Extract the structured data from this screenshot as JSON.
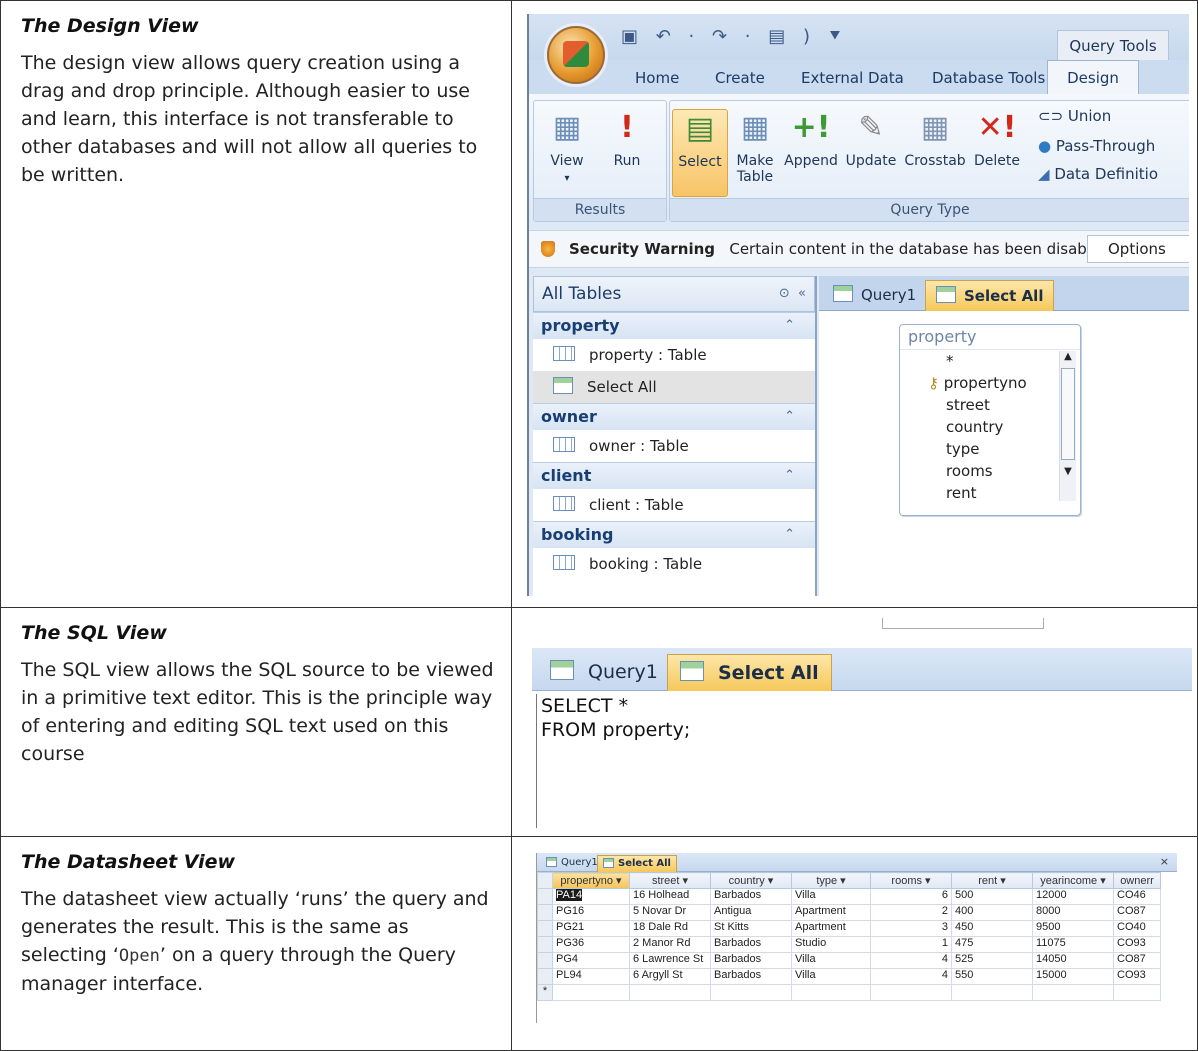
{
  "rows": [
    {
      "title": "The Design View",
      "body": "The design view allows query creation using a drag and drop principle. Although easier to use and learn, this interface is not transferable to other databases and will not allow all queries to be written."
    },
    {
      "title": "The SQL View",
      "body": "The SQL view allows the SQL source to be viewed in a primitive text editor. This is the principle way of entering and editing SQL text used on this course"
    },
    {
      "title": "The Datasheet View",
      "body_before": "The datasheet view actually ‘runs’ the query and generates the result. This is the same as selecting ‘",
      "body_code": "Open",
      "body_after": "’ on a query through the Query manager interface."
    }
  ],
  "design": {
    "context_tab": "Query Tools",
    "tabs": [
      "Home",
      "Create",
      "External Data",
      "Database Tools",
      "Design"
    ],
    "results_group": "Results",
    "query_type_group": "Query Type",
    "buttons": {
      "view": "View",
      "run": "Run",
      "select": "Select",
      "make_table_1": "Make",
      "make_table_2": "Table",
      "append": "Append",
      "update": "Update",
      "crosstab": "Crosstab",
      "delete": "Delete"
    },
    "small_buttons": [
      "Union",
      "Pass-Through",
      "Data Definitio"
    ],
    "security_title": "Security Warning",
    "security_text": "Certain content in the database has been disabled",
    "options": "Options",
    "nav_title": "All Tables",
    "nav_groups": [
      {
        "name": "property",
        "items": [
          "property : Table",
          "Select All"
        ]
      },
      {
        "name": "owner",
        "items": [
          "owner : Table"
        ]
      },
      {
        "name": "client",
        "items": [
          "client : Table"
        ]
      },
      {
        "name": "booking",
        "items": [
          "booking : Table"
        ]
      }
    ],
    "doc_tabs": [
      "Query1",
      "Select All"
    ],
    "table_box_title": "property",
    "fields": [
      "*",
      "propertyno",
      "street",
      "country",
      "type",
      "rooms",
      "rent"
    ]
  },
  "sql": {
    "tabs": [
      "Query1",
      "Select All"
    ],
    "line1": "SELECT *",
    "line2": "FROM property;"
  },
  "datasheet": {
    "tabs": [
      "Query1",
      "Select All"
    ],
    "close": "×",
    "columns": [
      "propertyno",
      "street",
      "country",
      "type",
      "rooms",
      "rent",
      "yearincome",
      "ownerr"
    ],
    "rows": [
      [
        "PA14",
        "16 Holhead",
        "Barbados",
        "Villa",
        "6",
        "500",
        "12000",
        "CO46"
      ],
      [
        "PG16",
        "5 Novar Dr",
        "Antigua",
        "Apartment",
        "2",
        "400",
        "8000",
        "CO87"
      ],
      [
        "PG21",
        "18 Dale Rd",
        "St Kitts",
        "Apartment",
        "3",
        "450",
        "9500",
        "CO40"
      ],
      [
        "PG36",
        "2 Manor Rd",
        "Barbados",
        "Studio",
        "1",
        "475",
        "11075",
        "CO93"
      ],
      [
        "PG4",
        "6 Lawrence St",
        "Barbados",
        "Villa",
        "4",
        "525",
        "14050",
        "CO87"
      ],
      [
        "PL94",
        "6 Argyll St",
        "Barbados",
        "Villa",
        "4",
        "550",
        "15000",
        "CO93"
      ]
    ],
    "new_row_marker": "*"
  }
}
